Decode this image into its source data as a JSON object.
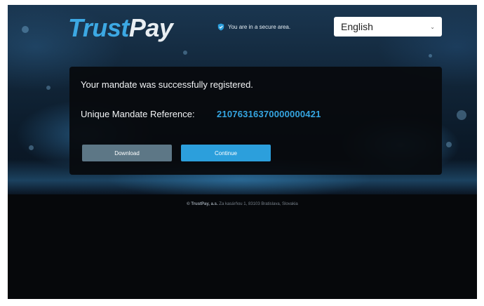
{
  "header": {
    "logo_part1": "Trust",
    "logo_part2": "Pay",
    "secure_text": "You are in a secure area.",
    "language": {
      "selected": "English"
    }
  },
  "card": {
    "message": "Your mandate was successfully registered.",
    "reference_label": "Unique Mandate Reference:",
    "reference_value": "21076316370000000421",
    "download_label": "Download",
    "continue_label": "Continue"
  },
  "footer": {
    "brand": "© TrustPay, a.s.",
    "address": " Za kasárňou 1, 83103 Bratislava, Slovakia"
  },
  "colors": {
    "accent": "#2c9fdc",
    "reference": "#35a6e2",
    "download_button": "#5d7786",
    "card_bg": "#08090d",
    "page_bg": "#06080b"
  },
  "icons": {
    "secure": "shield-check-icon",
    "dropdown": "chevron-down-icon"
  }
}
